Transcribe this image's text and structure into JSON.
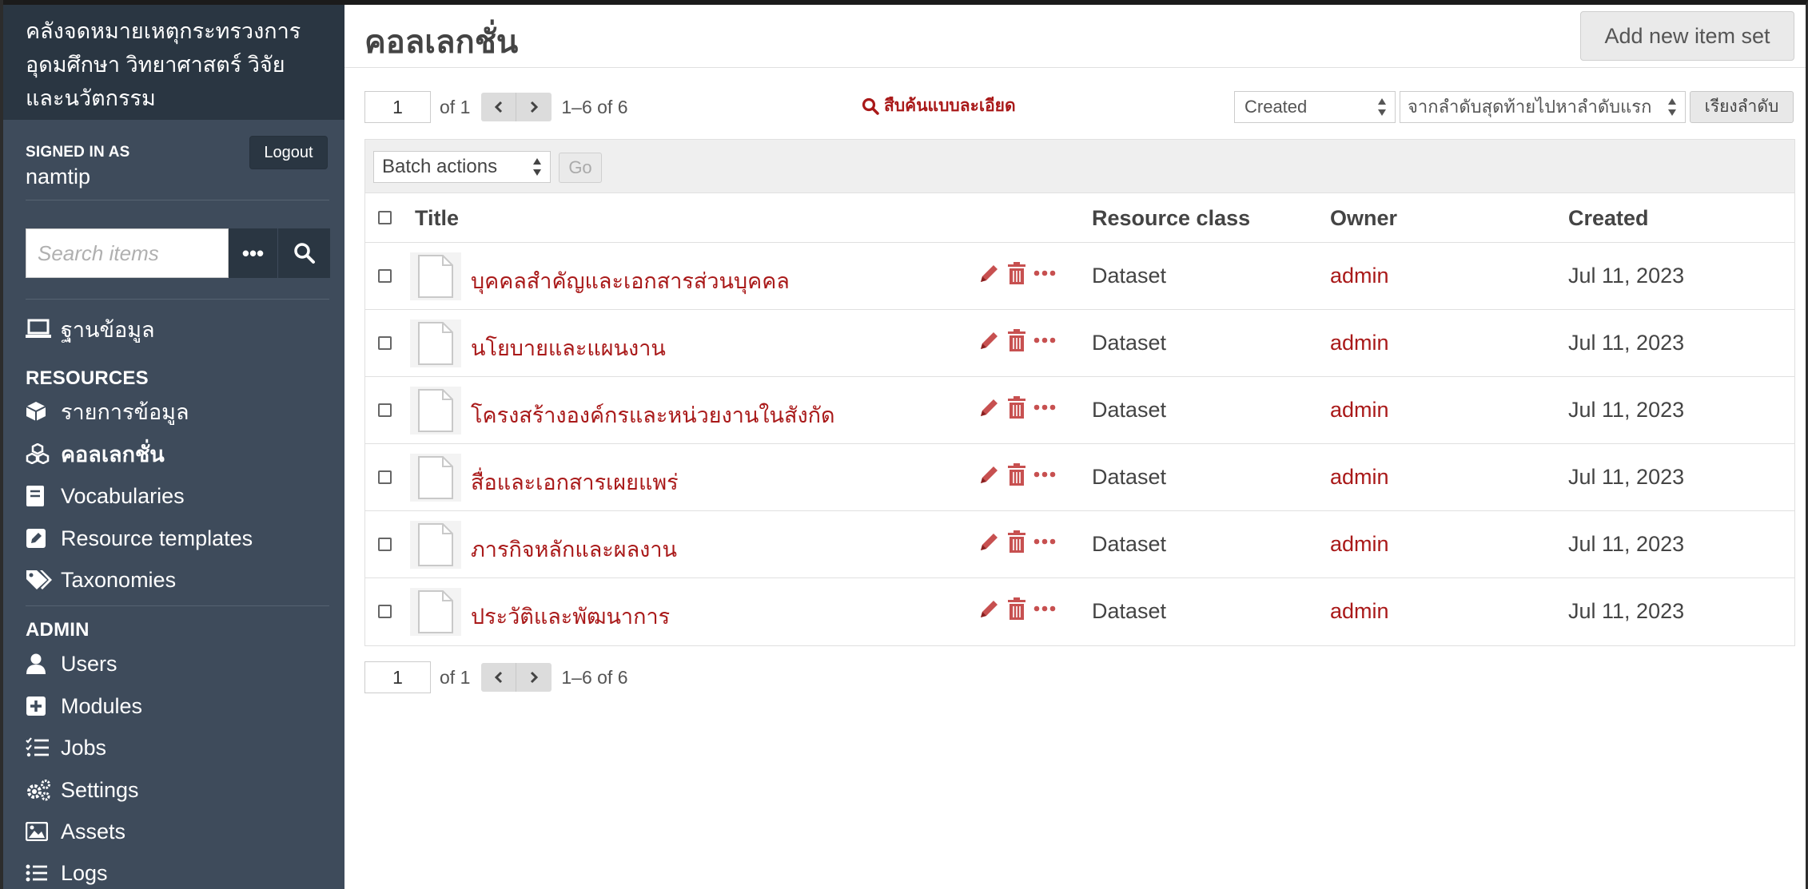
{
  "sidebar": {
    "site_title": "คลังจดหมายเหตุกระทรวงการอุดมศึกษา วิทยาศาสตร์ วิจัยและนวัตกรรม",
    "signed_in_label": "SIGNED IN AS",
    "username": "namtip",
    "logout_label": "Logout",
    "search_placeholder": "Search items",
    "nav_top": {
      "label": "ฐานข้อมูล",
      "icon": "laptop-icon"
    },
    "resources_heading": "RESOURCES",
    "resources": [
      {
        "label": "รายการข้อมูล",
        "icon": "cube-icon"
      },
      {
        "label": "คอลเลกชั่น",
        "icon": "cubes-icon",
        "active": true
      },
      {
        "label": "Vocabularies",
        "icon": "book-icon"
      },
      {
        "label": "Resource templates",
        "icon": "edit-icon"
      },
      {
        "label": "Taxonomies",
        "icon": "tags-icon"
      }
    ],
    "admin_heading": "ADMIN",
    "admin": [
      {
        "label": "Users",
        "icon": "user-icon"
      },
      {
        "label": "Modules",
        "icon": "plus-square-icon"
      },
      {
        "label": "Jobs",
        "icon": "tasks-icon"
      },
      {
        "label": "Settings",
        "icon": "cogs-icon"
      },
      {
        "label": "Assets",
        "icon": "image-icon"
      },
      {
        "label": "Logs",
        "icon": "list-icon"
      }
    ]
  },
  "main": {
    "title": "คอลเลกชั่น",
    "add_button": "Add new item set",
    "pager": {
      "page": "1",
      "of": "of 1",
      "range": "1–6 of 6"
    },
    "advanced_search": "สืบค้นแบบละเอียด",
    "sort_by": "Created",
    "sort_order": "จากลำดับสุดท้ายไปหาลำดับแรก",
    "sort_button": "เรียงลำดับ",
    "batch_actions": "Batch actions",
    "go_button": "Go",
    "columns": {
      "title": "Title",
      "resource_class": "Resource class",
      "owner": "Owner",
      "created": "Created"
    },
    "rows": [
      {
        "title": "บุคคลสำคัญและเอกสารส่วนบุคคล",
        "resource_class": "Dataset",
        "owner": "admin",
        "created": "Jul 11, 2023"
      },
      {
        "title": "นโยบายและแผนงาน",
        "resource_class": "Dataset",
        "owner": "admin",
        "created": "Jul 11, 2023"
      },
      {
        "title": "โครงสร้างองค์กรและหน่วยงานในสังกัด",
        "resource_class": "Dataset",
        "owner": "admin",
        "created": "Jul 11, 2023"
      },
      {
        "title": "สื่อและเอกสารเผยแพร่",
        "resource_class": "Dataset",
        "owner": "admin",
        "created": "Jul 11, 2023"
      },
      {
        "title": "ภารกิจหลักและผลงาน",
        "resource_class": "Dataset",
        "owner": "admin",
        "created": "Jul 11, 2023"
      },
      {
        "title": "ประวัติและพัฒนาการ",
        "resource_class": "Dataset",
        "owner": "admin",
        "created": "Jul 11, 2023"
      }
    ]
  },
  "colors": {
    "sidebar_bg": "#3e4b5b",
    "sidebar_header_bg": "#2a3642",
    "link_red": "#a91919"
  }
}
